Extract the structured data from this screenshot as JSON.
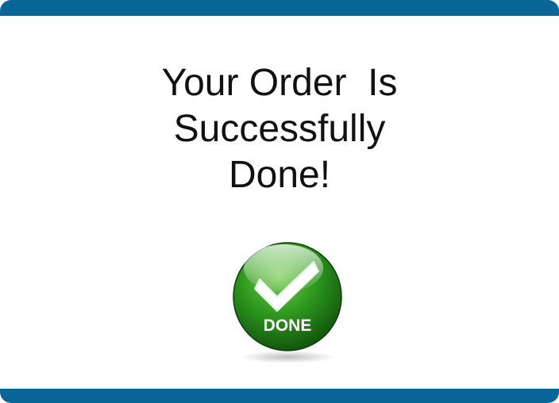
{
  "window": {
    "accent_color": "#0a6696"
  },
  "message": {
    "line1": "Your Order  Is",
    "line2": "Successfully",
    "line3": "Done!"
  },
  "done_badge": {
    "label": "DONE",
    "icon": "checkmark-icon",
    "color": "#1f8a1f"
  }
}
